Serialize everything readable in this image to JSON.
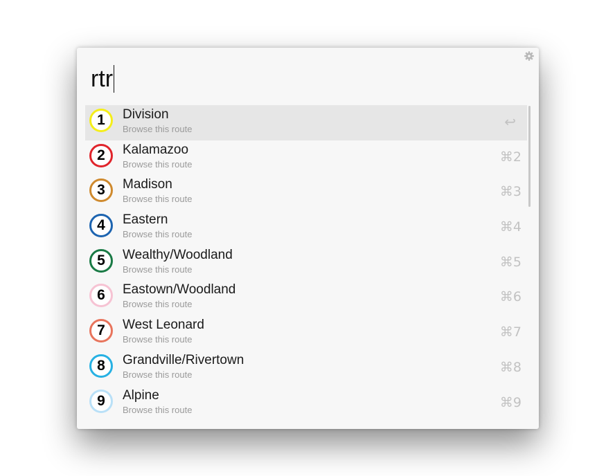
{
  "search": {
    "query": "rtr"
  },
  "results": [
    {
      "number": "1",
      "title": "Division",
      "subtitle": "Browse this route",
      "shortcut": "↩",
      "color": "#f5ee1a",
      "selected": true
    },
    {
      "number": "2",
      "title": "Kalamazoo",
      "subtitle": "Browse this route",
      "shortcut": "⌘2",
      "color": "#e0242b",
      "selected": false
    },
    {
      "number": "3",
      "title": "Madison",
      "subtitle": "Browse this route",
      "shortcut": "⌘3",
      "color": "#cf8a2e",
      "selected": false
    },
    {
      "number": "4",
      "title": "Eastern",
      "subtitle": "Browse this route",
      "shortcut": "⌘4",
      "color": "#1d64b0",
      "selected": false
    },
    {
      "number": "5",
      "title": "Wealthy/Woodland",
      "subtitle": "Browse this route",
      "shortcut": "⌘5",
      "color": "#1a7a45",
      "selected": false
    },
    {
      "number": "6",
      "title": "Eastown/Woodland",
      "subtitle": "Browse this route",
      "shortcut": "⌘6",
      "color": "#f6c3d3",
      "selected": false
    },
    {
      "number": "7",
      "title": "West Leonard",
      "subtitle": "Browse this route",
      "shortcut": "⌘7",
      "color": "#e8745c",
      "selected": false
    },
    {
      "number": "8",
      "title": "Grandville/Rivertown",
      "subtitle": "Browse this route",
      "shortcut": "⌘8",
      "color": "#27b1e3",
      "selected": false
    },
    {
      "number": "9",
      "title": "Alpine",
      "subtitle": "Browse this route",
      "shortcut": "⌘9",
      "color": "#b9e0f7",
      "selected": false
    }
  ],
  "icons": {
    "settings": "gear-icon"
  }
}
